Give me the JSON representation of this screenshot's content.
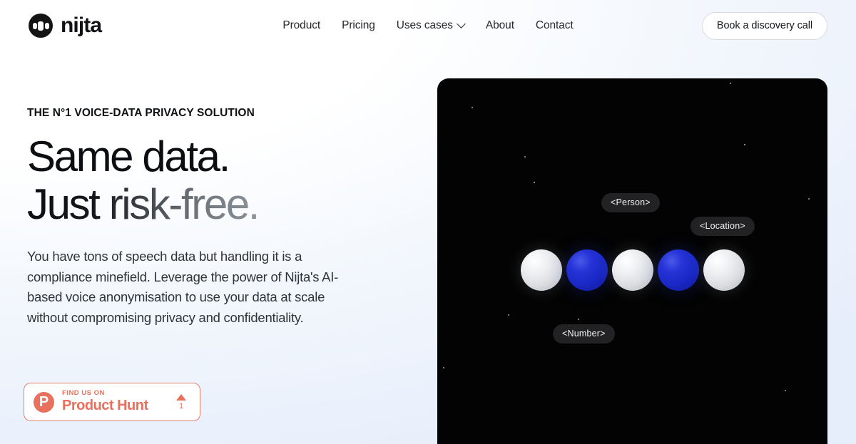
{
  "brand": {
    "name": "nijta",
    "logo_icon": "nijta-waveform-icon"
  },
  "nav": {
    "items": [
      {
        "label": "Product",
        "has_dropdown": false
      },
      {
        "label": "Pricing",
        "has_dropdown": false
      },
      {
        "label": "Uses cases",
        "has_dropdown": true,
        "dropdown_icon": "chevron-down-icon"
      },
      {
        "label": "About",
        "has_dropdown": false
      },
      {
        "label": "Contact",
        "has_dropdown": false
      }
    ],
    "cta_label": "Book a discovery call"
  },
  "hero": {
    "eyebrow": "THE N°1 VOICE-DATA PRIVACY SOLUTION",
    "headline_line1": "Same data.",
    "headline_line2": "Just risk-free.",
    "body": "You have tons of speech data but handling it is a compliance minefield. Leverage the power of Nijta's AI-based voice anonymisation to use your data at scale without compromising privacy and confidentiality."
  },
  "product_hunt": {
    "logo_letter": "P",
    "kicker": "FIND US ON",
    "title": "Product Hunt",
    "upvote_icon": "upvote-triangle-icon",
    "upvote_count": "1",
    "accent_color": "#e8705c"
  },
  "visual": {
    "background_color": "#030303",
    "spheres": [
      {
        "color": "light"
      },
      {
        "color": "blue"
      },
      {
        "color": "light"
      },
      {
        "color": "blue"
      },
      {
        "color": "light"
      }
    ],
    "labels": [
      {
        "text": "<Person>"
      },
      {
        "text": "<Location>"
      },
      {
        "text": "<Number>"
      }
    ]
  }
}
